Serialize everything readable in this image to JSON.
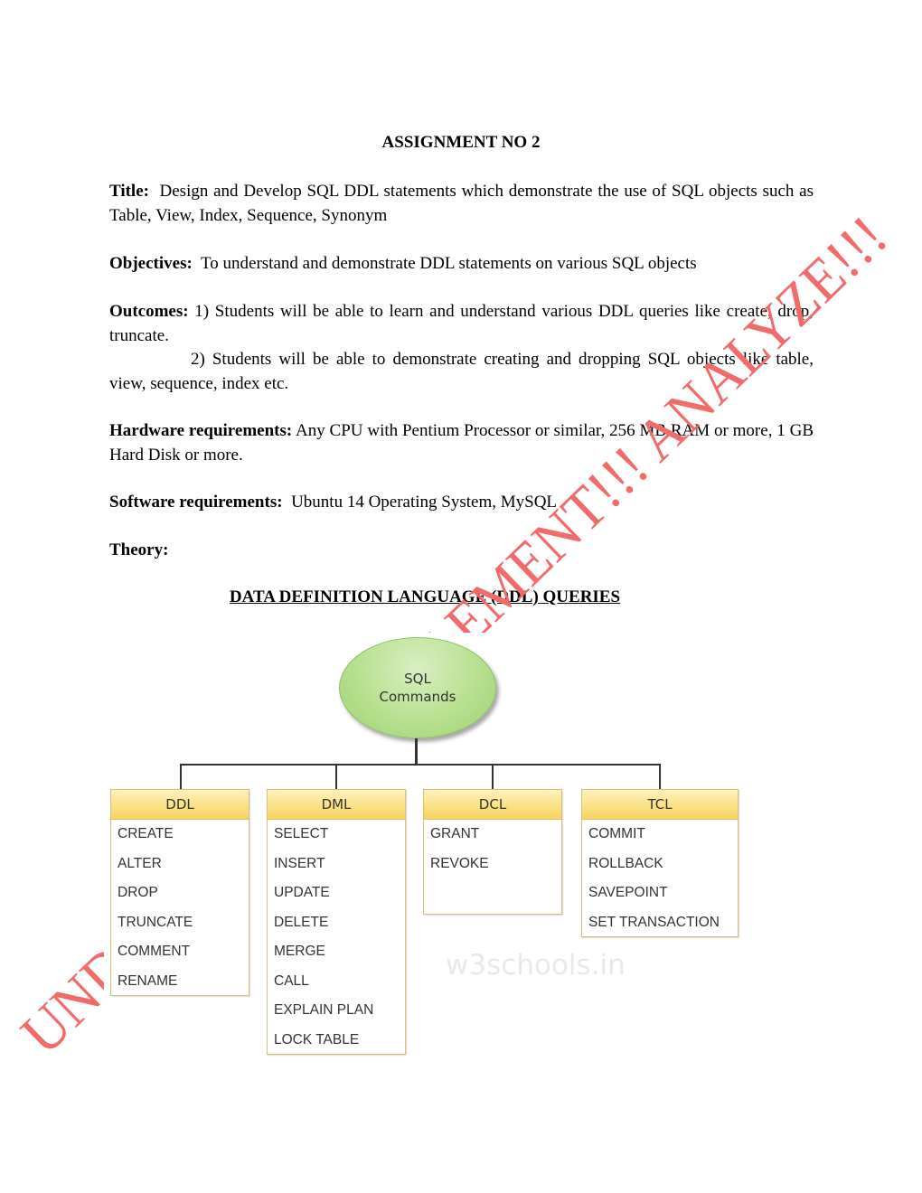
{
  "document": {
    "heading": "ASSIGNMENT NO 2",
    "title": {
      "label": "Title:",
      "text": "Design and Develop SQL DDL statements which demonstrate the use of SQL objects such as Table, View, Index, Sequence, Synonym"
    },
    "objectives": {
      "label": "Objectives:",
      "text": "To understand and demonstrate DDL statements on various SQL objects"
    },
    "outcomes": {
      "label": "Outcomes:",
      "item1": "1) Students will be able to learn and understand various DDL queries like create, drop, truncate.",
      "item2": "2) Students will be able to demonstrate creating and dropping SQL objects like table, view, sequence, index etc."
    },
    "hardware": {
      "label": "Hardware requirements:",
      "text": "Any CPU with Pentium Processor or similar, 256 MB RAM or more, 1 GB Hard Disk or more."
    },
    "software": {
      "label": "Software requirements:",
      "text": "Ubuntu 14 Operating System, MySQL"
    },
    "theory": {
      "label": "Theory:"
    },
    "section_heading": "DATA DEFINITION LANGUAGE (DDL) QUERIES"
  },
  "diagram": {
    "root": {
      "line1": "SQL",
      "line2": "Commands"
    },
    "categories": [
      {
        "name": "DDL",
        "items": [
          "CREATE",
          "ALTER",
          "DROP",
          "TRUNCATE",
          "COMMENT",
          "RENAME"
        ]
      },
      {
        "name": "DML",
        "items": [
          "SELECT",
          "INSERT",
          "UPDATE",
          "DELETE",
          "MERGE",
          "CALL",
          "EXPLAIN PLAN",
          "LOCK TABLE"
        ]
      },
      {
        "name": "DCL",
        "items": [
          "GRANT",
          "REVOKE"
        ]
      },
      {
        "name": "TCL",
        "items": [
          "COMMIT",
          "ROLLBACK",
          "SAVEPOINT",
          "SET TRANSACTION"
        ]
      }
    ],
    "site_watermark": "w3schools.in"
  },
  "watermark": {
    "text": "UNDERSTAND!!! IMPLEMENT!!! ANALYZE!!!",
    "color": "#f26b6b"
  },
  "colors": {
    "header_top": "#fdf1bd",
    "header_bottom": "#f8d45c",
    "box_border": "#d8c07a",
    "root_fill": "#b7e08f"
  }
}
